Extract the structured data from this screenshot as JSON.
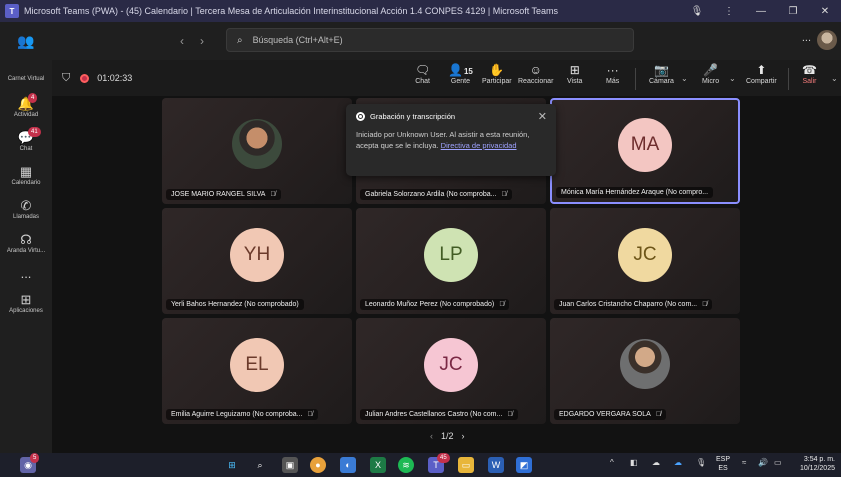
{
  "window": {
    "title": "Microsoft Teams (PWA) - (45) Calendario | Tercera Mesa de Articulación Interinstitucional Acción 1.4 CONPES 4129 | Microsoft Teams"
  },
  "topbar": {
    "search_placeholder": "Búsqueda (Ctrl+Alt+E)",
    "more_label": "..."
  },
  "rail": {
    "camet_label": "Carnet Virtual",
    "items": [
      {
        "label": "Actividad",
        "badge": "4",
        "icon": "bell-icon"
      },
      {
        "label": "Chat",
        "badge": "41",
        "icon": "chat-icon"
      },
      {
        "label": "Calendario",
        "badge": "",
        "icon": "calendar-icon"
      },
      {
        "label": "Llamadas",
        "badge": "",
        "icon": "phone-icon"
      },
      {
        "label": "Aranda Virtu...",
        "badge": "",
        "icon": "headset-icon"
      },
      {
        "label": "...",
        "badge": "",
        "icon": "more-icon"
      },
      {
        "label": "Aplicaciones",
        "badge": "",
        "icon": "apps-icon"
      }
    ]
  },
  "meeting": {
    "timer": "01:02:33",
    "participants_count": "15",
    "tools": {
      "chat": "Chat",
      "people": "Gente",
      "raise": "Participar",
      "react": "Reaccionar",
      "view": "Vista",
      "more": "Más",
      "camera": "Cámara",
      "mic": "Micro",
      "share": "Compartir",
      "leave": "Salir"
    }
  },
  "tiles": [
    {
      "name": "JOSE MARIO RANGEL SILVA",
      "initials": "",
      "photo": true
    },
    {
      "name": "Gabriela Solorzano Ardila (No comproba...",
      "initials": "",
      "photo": false
    },
    {
      "name": "Mónica María Hernández Araque (No compro...",
      "initials": "MA",
      "photo": false
    },
    {
      "name": "Yerli Bahos Hernandez (No comprobado)",
      "initials": "YH",
      "photo": false
    },
    {
      "name": "Leonardo Muñoz Perez (No comprobado)",
      "initials": "LP",
      "photo": false
    },
    {
      "name": "Juan Carlos Cristancho Chaparro (No com...",
      "initials": "JC",
      "photo": false
    },
    {
      "name": "Emilia Aguirre Leguizamo (No comproba...",
      "initials": "EL",
      "photo": false
    },
    {
      "name": "Julian Andres Castellanos Castro (No com...",
      "initials": "JC",
      "photo": false
    },
    {
      "name": "EDGARDO VERGARA SOLA",
      "initials": "",
      "photo": true
    }
  ],
  "popup": {
    "title": "Grabación y transcripción",
    "text": "Iniciado por Unknown User. Al asistir a esta reunión, acepta que se le incluya.",
    "link": "Directiva de privacidad"
  },
  "pager": {
    "label": "1/2"
  },
  "taskbar": {
    "start_badge": "5",
    "teams_badge": "45",
    "lang_top": "ESP",
    "lang_bottom": "ES",
    "time": "3:54 p. m.",
    "date": "10/12/2025"
  },
  "colors": {
    "accent": "#5b5fc7",
    "recording": "#c4314b",
    "active_border": "#8b8fff"
  }
}
